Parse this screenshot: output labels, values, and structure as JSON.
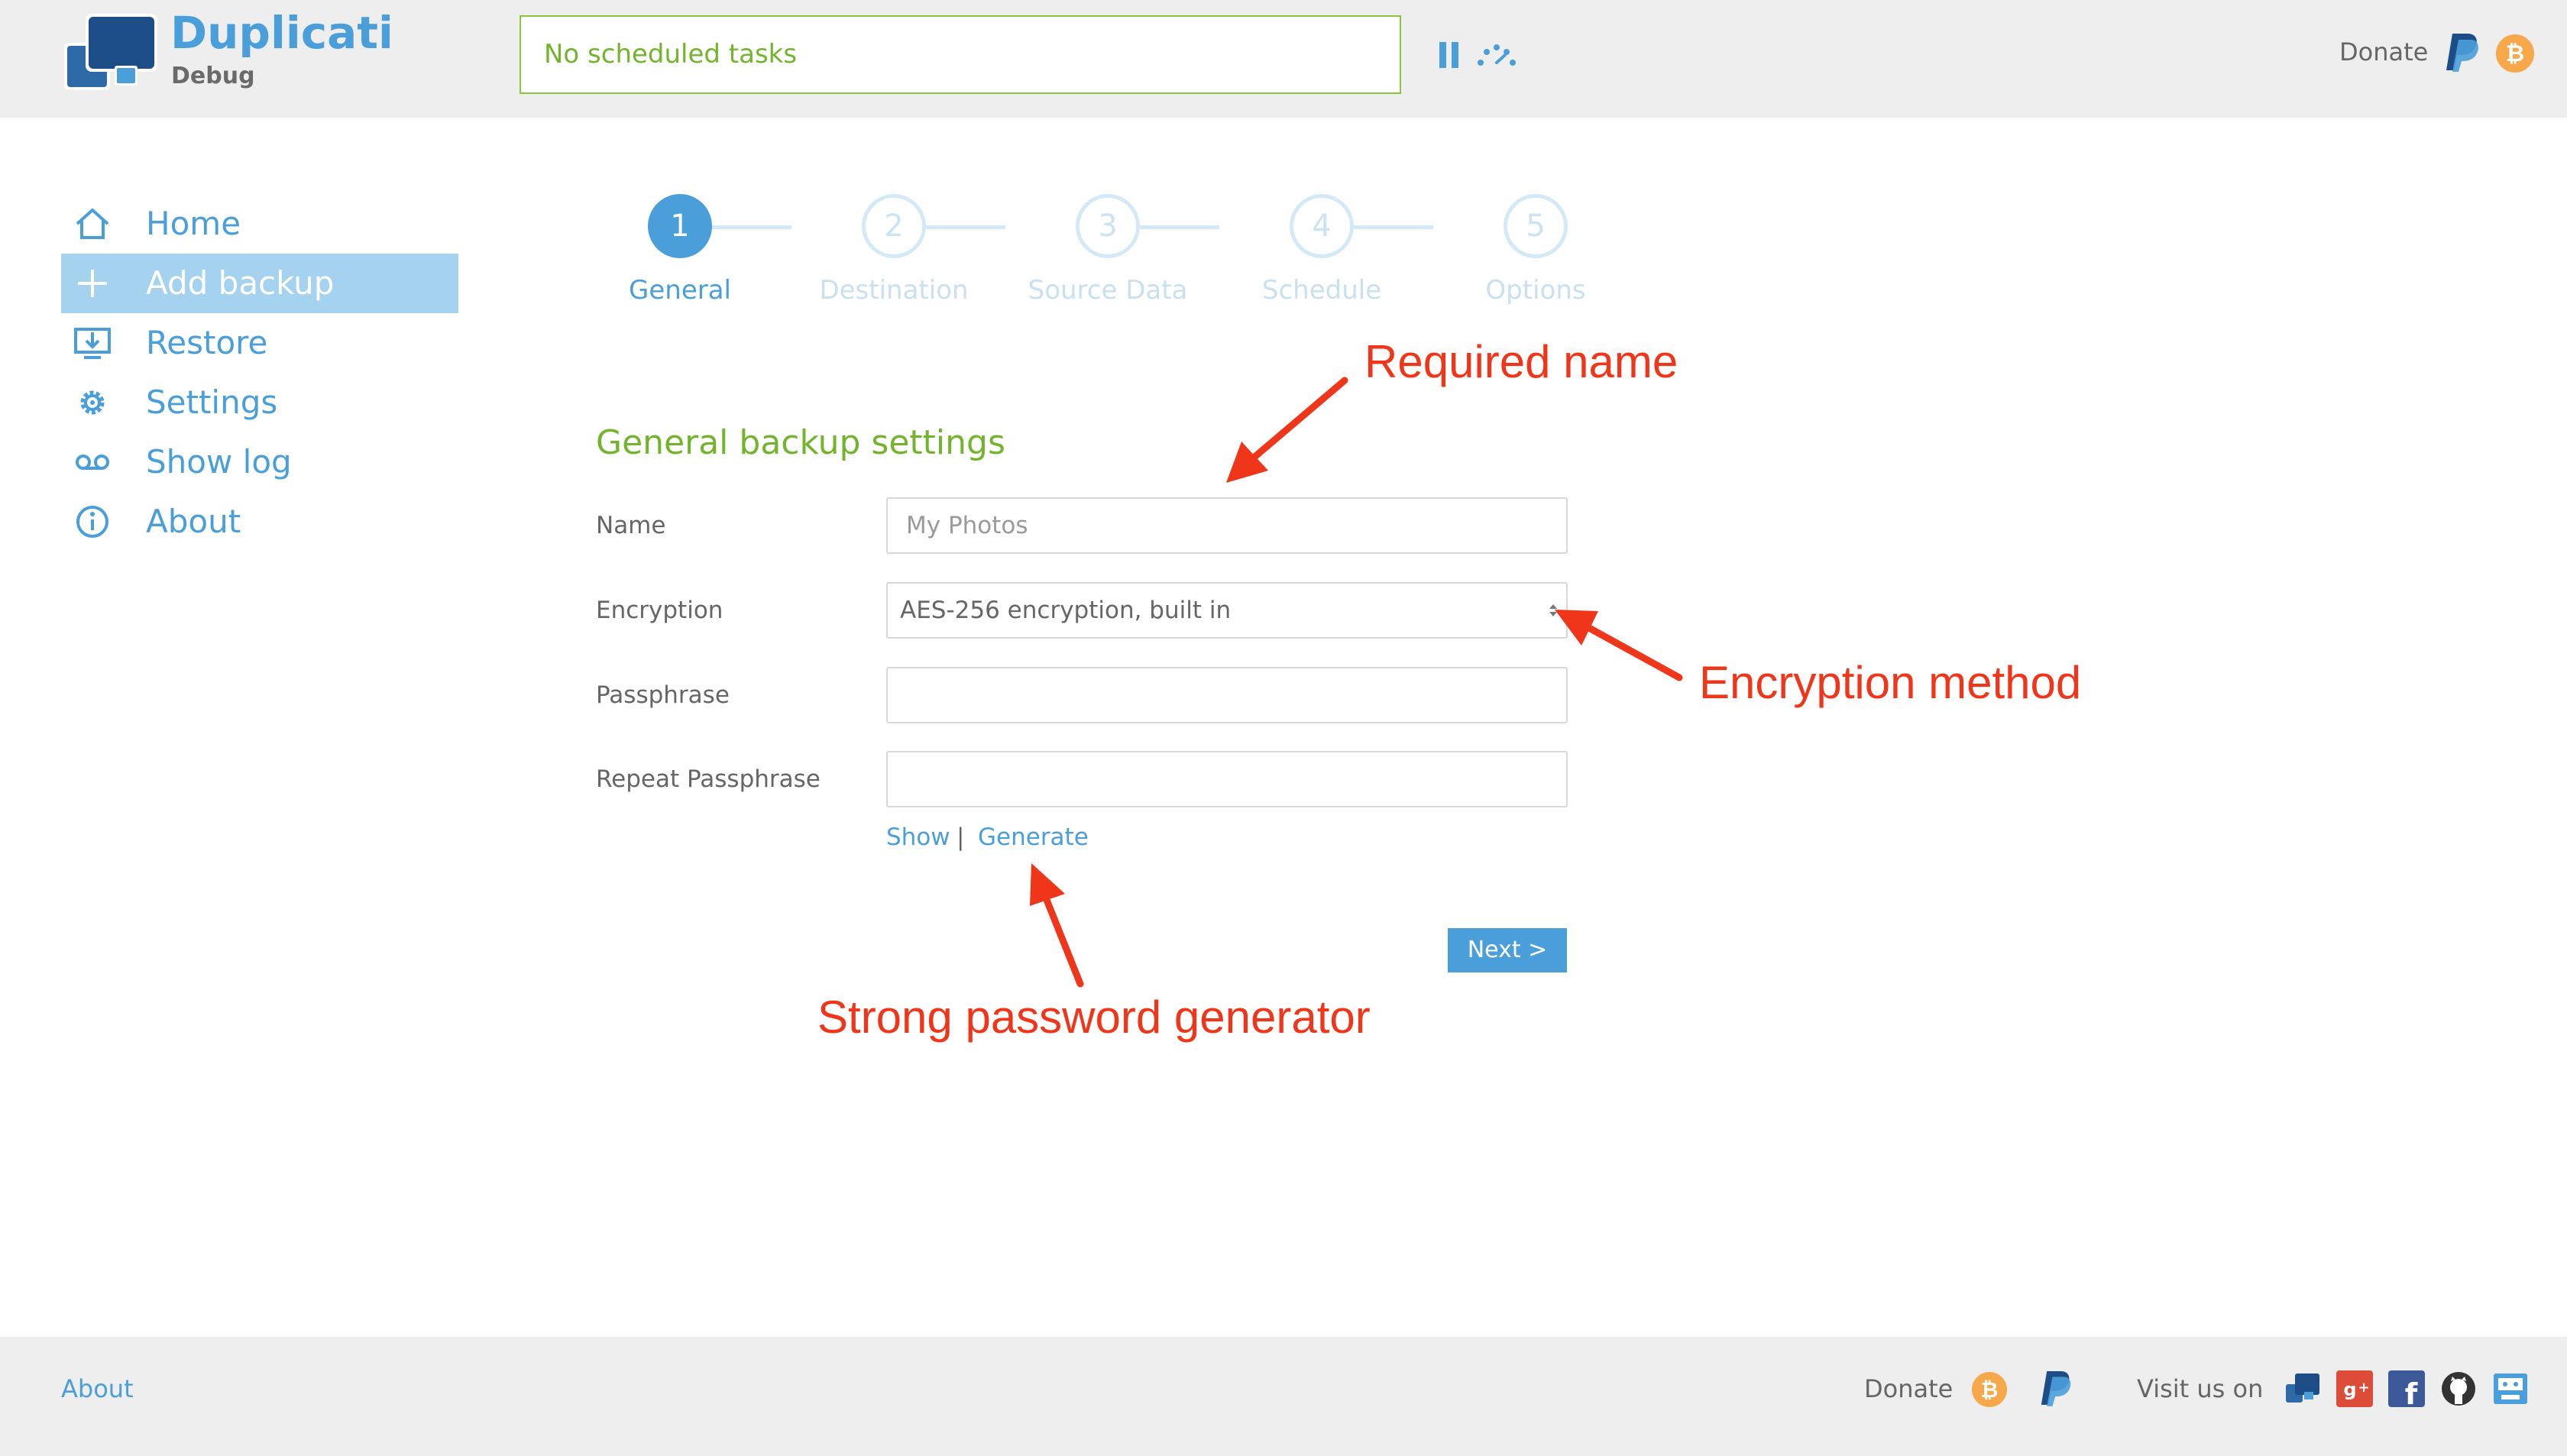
{
  "header": {
    "app_name": "Duplicati",
    "app_subtitle": "Debug",
    "status_text": "No scheduled tasks",
    "donate_label": "Donate"
  },
  "sidebar": {
    "items": [
      {
        "label": "Home",
        "icon": "home-icon",
        "active": false
      },
      {
        "label": "Add backup",
        "icon": "plus-icon",
        "active": true
      },
      {
        "label": "Restore",
        "icon": "restore-icon",
        "active": false
      },
      {
        "label": "Settings",
        "icon": "gear-icon",
        "active": false
      },
      {
        "label": "Show log",
        "icon": "log-icon",
        "active": false
      },
      {
        "label": "About",
        "icon": "info-icon",
        "active": false
      }
    ]
  },
  "wizard": {
    "steps": [
      {
        "number": "1",
        "label": "General",
        "active": true
      },
      {
        "number": "2",
        "label": "Destination",
        "active": false
      },
      {
        "number": "3",
        "label": "Source Data",
        "active": false
      },
      {
        "number": "4",
        "label": "Schedule",
        "active": false
      },
      {
        "number": "5",
        "label": "Options",
        "active": false
      }
    ]
  },
  "form": {
    "section_title": "General backup settings",
    "name_label": "Name",
    "name_placeholder": "My Photos",
    "name_value": "",
    "encryption_label": "Encryption",
    "encryption_value": "AES-256 encryption, built in",
    "passphrase_label": "Passphrase",
    "passphrase_value": "",
    "repeat_label": "Repeat Passphrase",
    "repeat_value": "",
    "show_link": "Show",
    "separator": "|",
    "generate_link": "Generate",
    "next_button": "Next >"
  },
  "annotations": {
    "required_name": "Required name",
    "encryption_method": "Encryption method",
    "password_generator": "Strong password generator"
  },
  "footer": {
    "about_link": "About",
    "donate_label": "Donate",
    "visit_label": "Visit us on",
    "social_icons": [
      "duplicati-icon",
      "google-plus-icon",
      "facebook-icon",
      "github-icon",
      "issue-tracker-icon"
    ]
  },
  "colors": {
    "accent_blue": "#4a9fda",
    "green": "#72b52c",
    "status_border": "#8cc63f",
    "annotation_red": "#f0361a",
    "active_nav_bg": "#a5d2ee",
    "header_bg": "#eeeeee"
  }
}
